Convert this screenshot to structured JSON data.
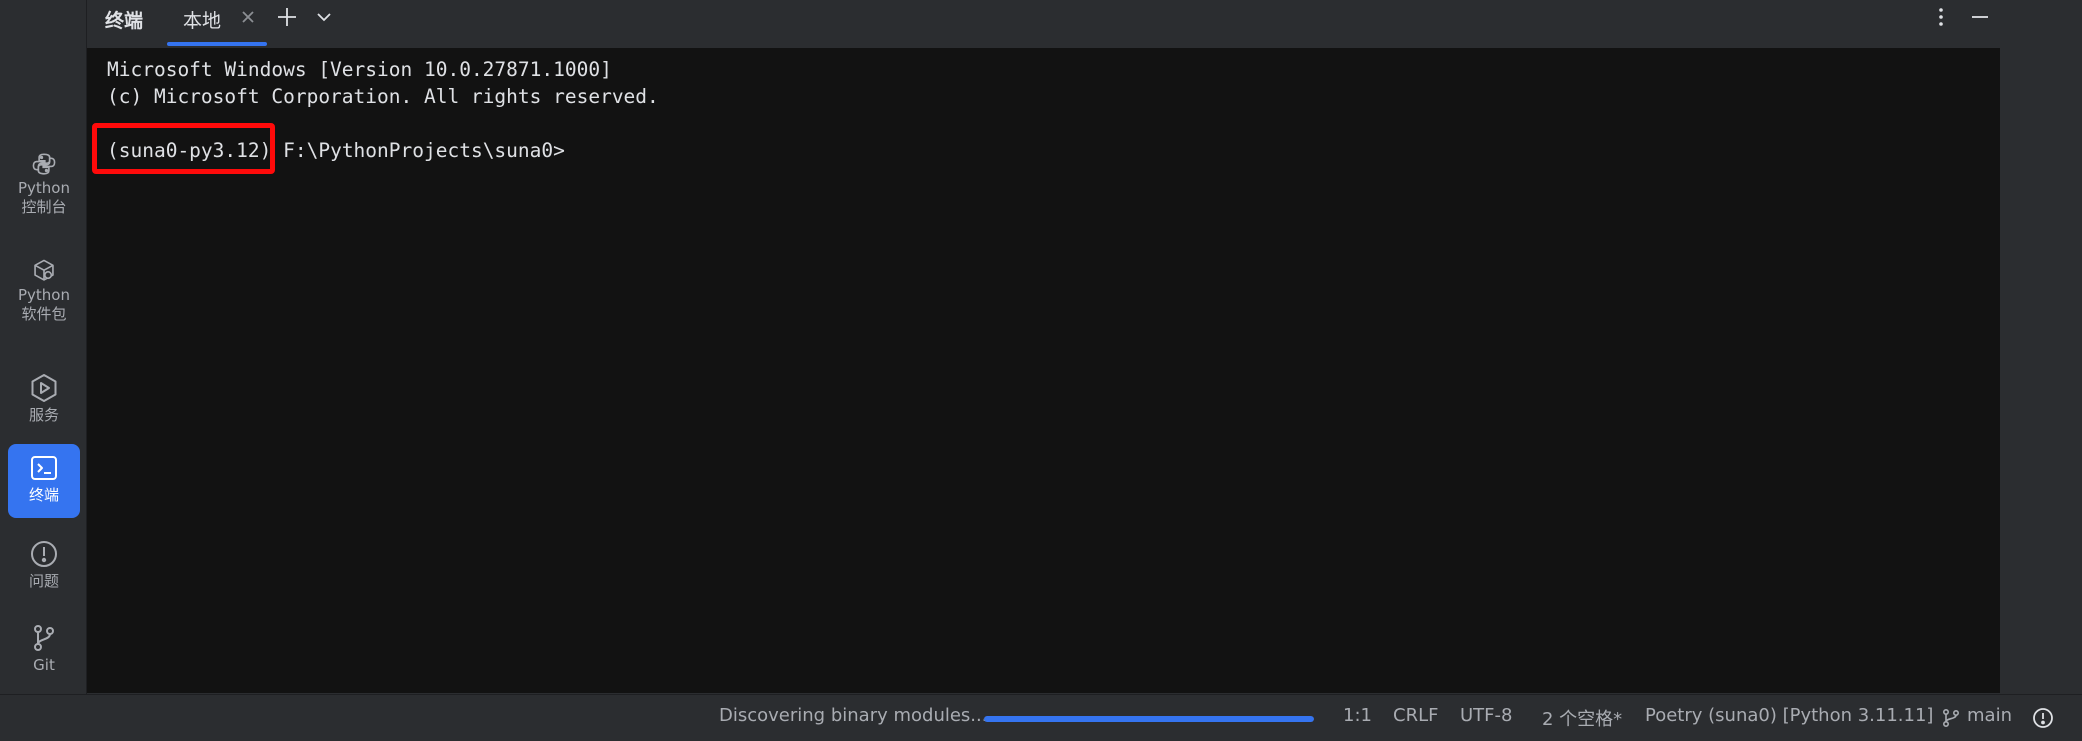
{
  "sidebar": {
    "items": [
      {
        "label": "Python\n控制台",
        "icon": "python-icon",
        "active": false
      },
      {
        "label": "Python\n软件包",
        "icon": "packages-icon",
        "active": false
      },
      {
        "label": "服务",
        "icon": "services-icon",
        "active": false
      },
      {
        "label": "终端",
        "icon": "terminal-icon",
        "active": true
      },
      {
        "label": "问题",
        "icon": "problems-icon",
        "active": false
      },
      {
        "label": "Git",
        "icon": "git-icon",
        "active": false
      }
    ]
  },
  "tabbar": {
    "panel_title": "终端",
    "tab_label": "本地",
    "close_glyph": "×",
    "add_glyph": "+",
    "icons": [
      "close-icon",
      "plus-icon",
      "chevron-down-icon",
      "more-vertical-icon",
      "minimize-icon"
    ]
  },
  "terminal": {
    "lines": [
      "Microsoft Windows [Version 10.0.27871.1000]",
      "(c) Microsoft Corporation. All rights reserved."
    ],
    "env_prefix": "(suna0-py3.12)",
    "prompt_path": " F:\\PythonProjects\\suna0>"
  },
  "statusbar": {
    "task": "Discovering binary modules...",
    "progress": 1.0,
    "position": "1:1",
    "line_ending": "CRLF",
    "encoding": "UTF-8",
    "indent": "2 个空格*",
    "interpreter": "Poetry (suna0) [Python 3.11.11]",
    "branch": "main"
  },
  "colors": {
    "accent": "#3574f0",
    "highlight": "#ff0a0a",
    "terminal_bg": "#121212",
    "chrome_bg": "#2b2d30"
  }
}
